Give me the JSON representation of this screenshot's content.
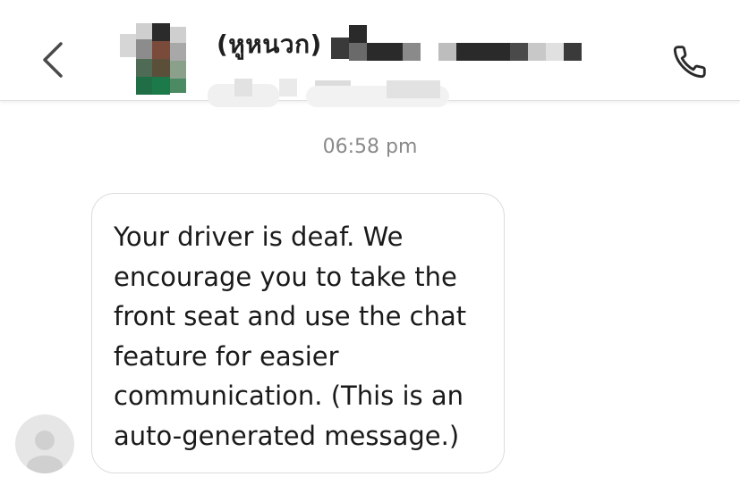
{
  "header": {
    "contact_name": "(หูหนวก)",
    "back_icon": "chevron-left-icon",
    "call_icon": "phone-icon"
  },
  "chat": {
    "timestamp": "06:58 pm",
    "messages": [
      {
        "text": "Your driver is deaf. We\nencourage you to take the\nfront seat and use the chat\nfeature for easier\ncommunication. (This is an\nauto-generated message.)"
      }
    ]
  },
  "colors": {
    "text": "#1a1a1a",
    "timestamp": "#8a8a8a",
    "bubble_border": "#dcdcdc",
    "avatar_placeholder": "#e6e6e6"
  }
}
